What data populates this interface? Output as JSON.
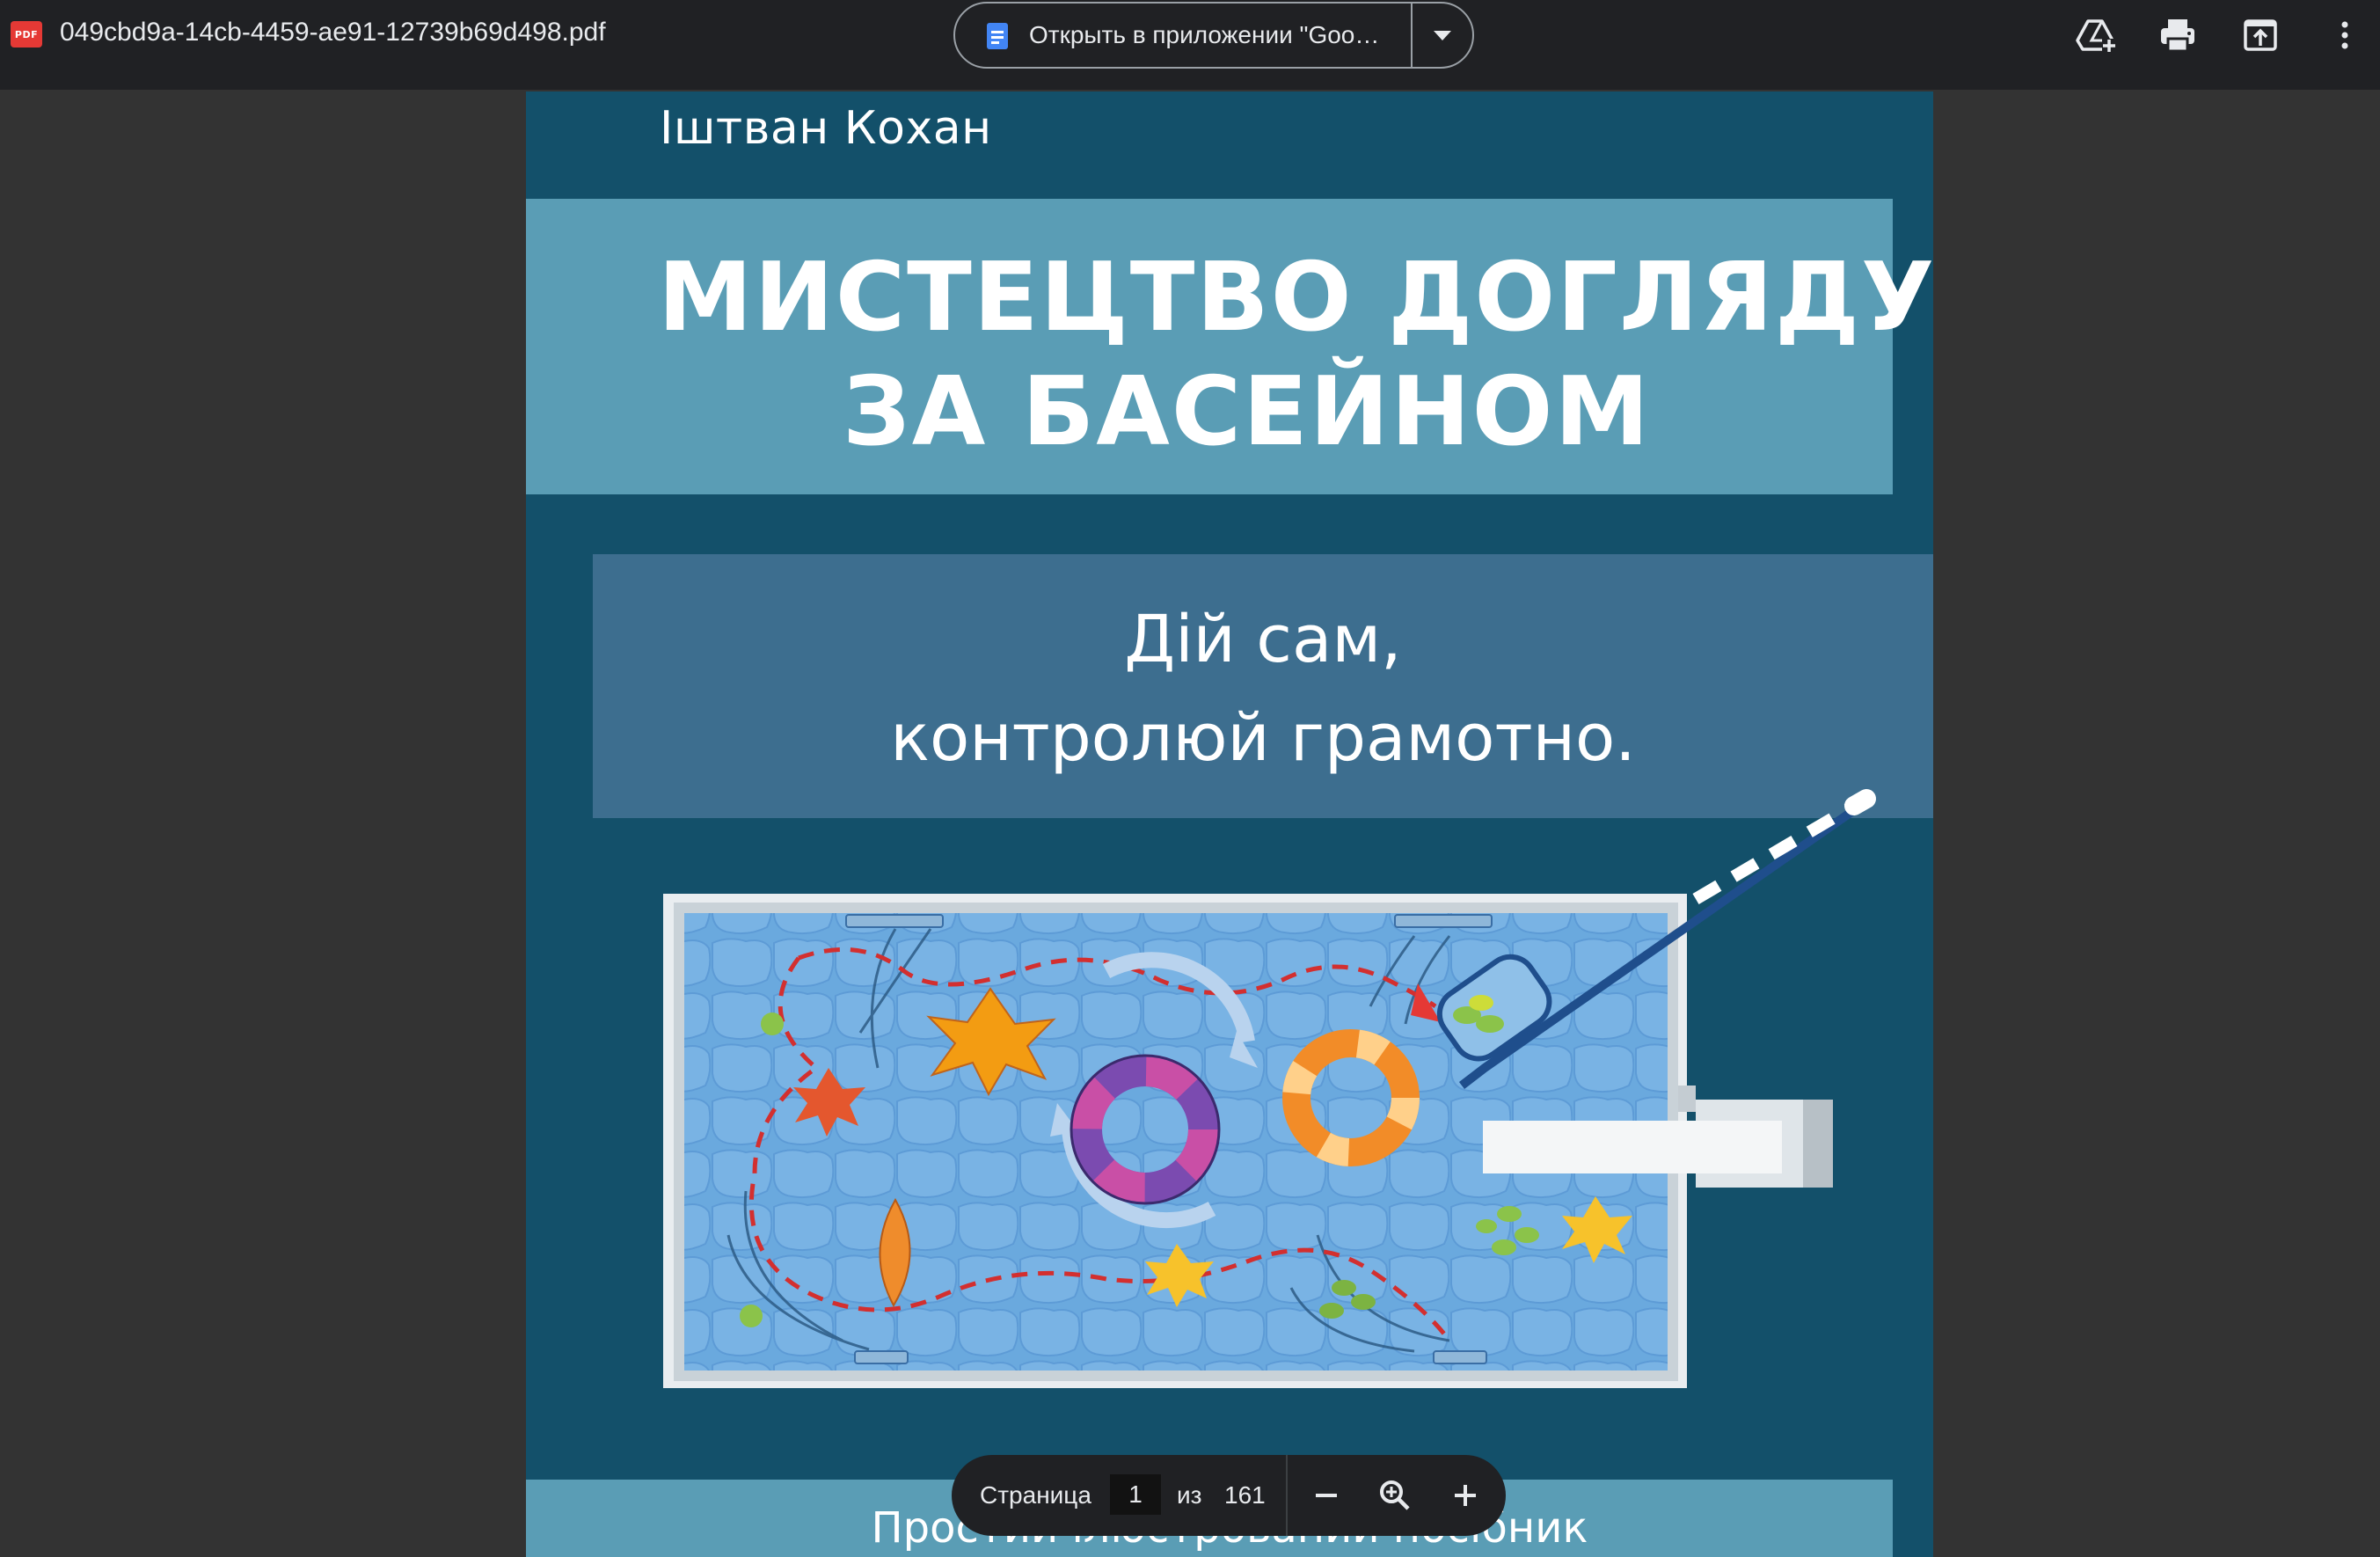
{
  "toolbar": {
    "file_icon_text": "PDF",
    "filename": "049cbd9a-14cb-4459-ae91-12739b69d498.pdf",
    "open_with_label": "Открыть в приложении \"Goo…",
    "icons": [
      "add-to-drive-icon",
      "print-icon",
      "open-in-new-icon",
      "more-vert-icon"
    ]
  },
  "cover": {
    "author": "Іштван Кохан",
    "title_line1": "МИСТЕЦТВО ДОГЛЯДУ",
    "title_line2": "ЗА БАСЕЙНОМ",
    "slogan_line1": "Дій сам,",
    "slogan_line2": "контролюй грамотно.",
    "subtitle": "Простий ілюстрований посібник",
    "colors": {
      "background": "#13506a",
      "title_band": "#5a9db5",
      "slogan_band": "#3d6e8f",
      "pool_water": "#6aa9de"
    }
  },
  "pagenav": {
    "page_label": "Страница",
    "current_page": "1",
    "of_label": "из",
    "total_pages": "161",
    "icons": [
      "zoom-out-icon",
      "zoom-fit-icon",
      "zoom-in-icon"
    ]
  }
}
